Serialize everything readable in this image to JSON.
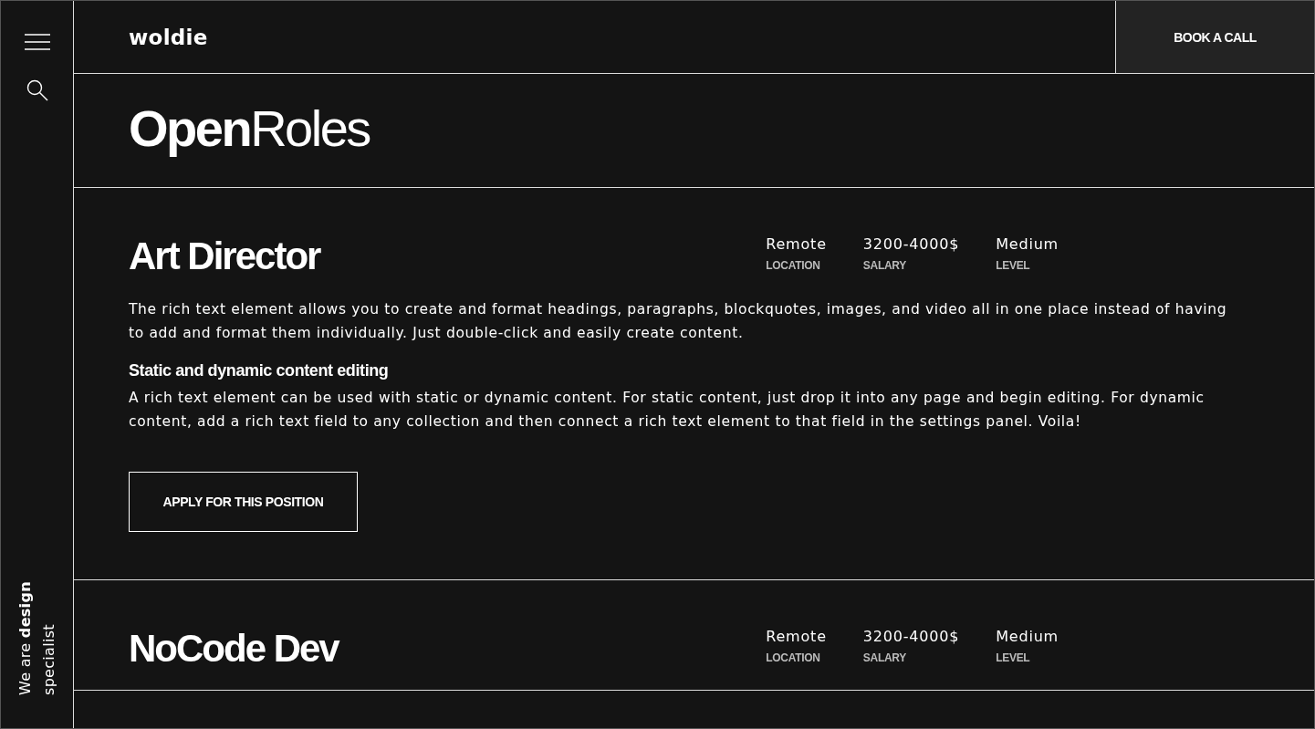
{
  "sidebar": {
    "tagline": "We are **design** specialist"
  },
  "header": {
    "logo": "woldie",
    "cta": "BOOK A CALL"
  },
  "page_title": "**Open**Roles",
  "roles": [
    {
      "title": "Art Director",
      "meta": [
        {
          "value": "Remote",
          "label": "LOCATION"
        },
        {
          "value": "3200-4000$",
          "label": "SALARY"
        },
        {
          "value": "Medium",
          "label": "LEVEL"
        }
      ],
      "intro": "The rich text element allows you to create and format headings, paragraphs, blockquotes, images, and video all in one place instead of having to add and format them individually. Just double-click and easily create content.",
      "subheading": "Static and dynamic content editing",
      "body": "A rich text element can be used with static or dynamic content. For static content, just drop it into any page and begin editing. For dynamic content, add a rich text field to any collection and then connect a rich text element to that field in the settings panel. Voila!",
      "apply": "APPLY FOR THIS POSITION"
    },
    {
      "title": "NoCode Dev",
      "meta": [
        {
          "value": "Remote",
          "label": "LOCATION"
        },
        {
          "value": "3200-4000$",
          "label": "SALARY"
        },
        {
          "value": "Medium",
          "label": "LEVEL"
        }
      ]
    }
  ]
}
